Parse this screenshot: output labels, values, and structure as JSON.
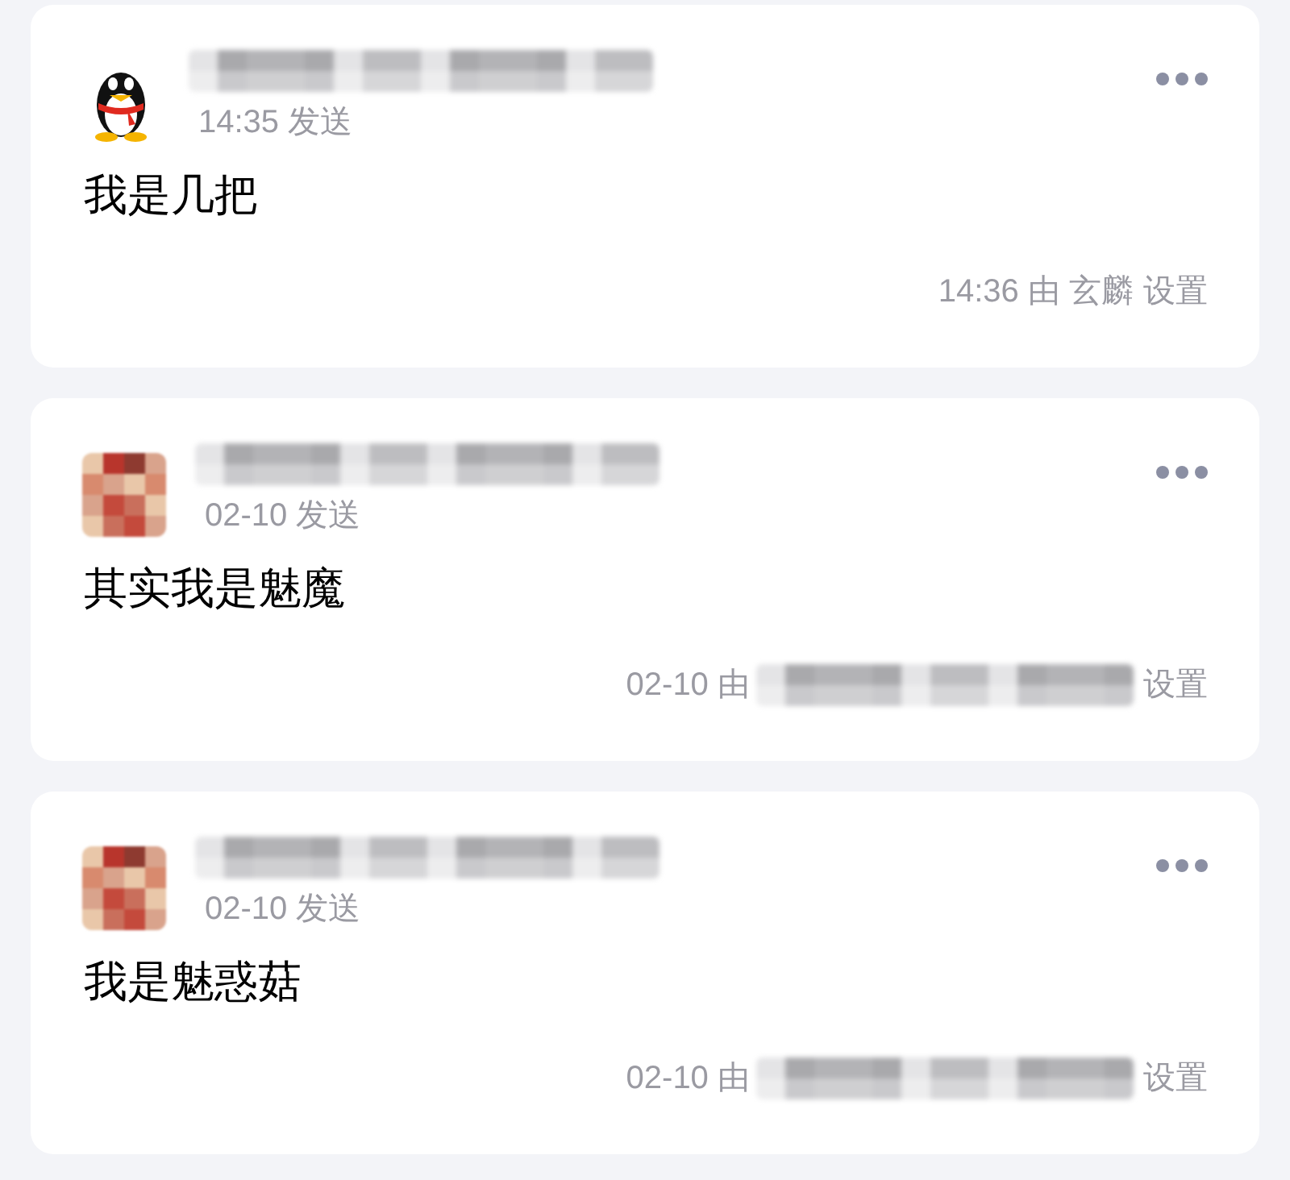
{
  "cards": [
    {
      "avatar": {
        "kind": "penguin"
      },
      "time": "14:35 发送",
      "message": "我是几把",
      "footer": {
        "text": "14:36 由 玄麟",
        "redacted": false,
        "action": "设置"
      }
    },
    {
      "avatar": {
        "kind": "pixelated"
      },
      "time": "02-10 发送",
      "message": "其实我是魅魔",
      "footer": {
        "text": "02-10 由",
        "redacted": true,
        "action": "设置"
      }
    },
    {
      "avatar": {
        "kind": "pixelated"
      },
      "time": "02-10 发送",
      "message": "我是魅惑菇",
      "footer": {
        "text": "02-10 由",
        "redacted": true,
        "action": "设置"
      }
    }
  ]
}
